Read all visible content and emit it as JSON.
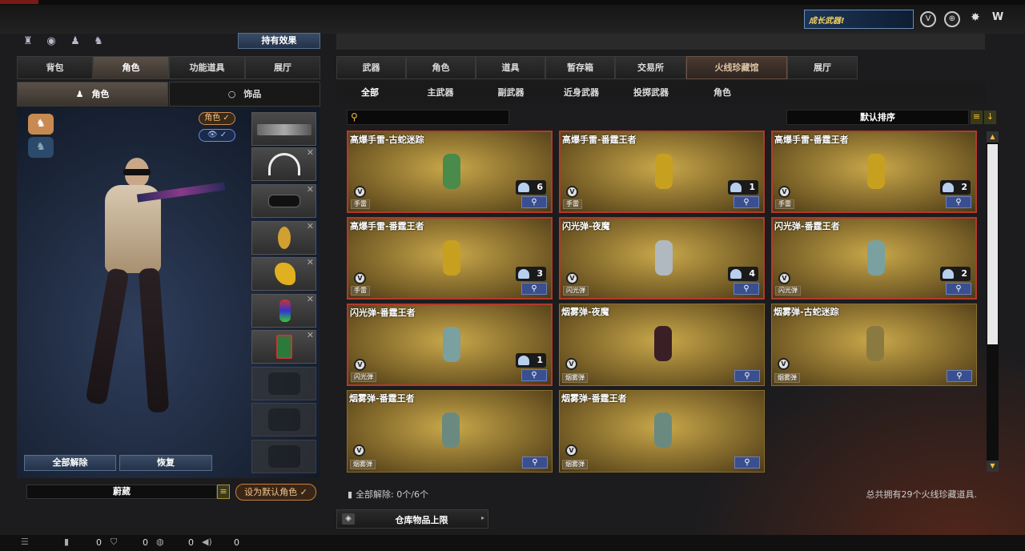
{
  "top": {
    "banner_text": "成长武器!",
    "icons": [
      "shield-v-icon",
      "crosshair-icon",
      "grenade-icon",
      "w-logo-icon"
    ]
  },
  "left": {
    "top_icons": [
      "stats-icon",
      "eye-icon",
      "person-icon",
      "bag-icon"
    ],
    "effect_button": "持有效果",
    "tabs": [
      "背包",
      "角色",
      "功能道具",
      "展厅"
    ],
    "active_tab": "角色",
    "subtabs": [
      "角色",
      "饰品"
    ],
    "active_subtab": "角色",
    "role_pill": "角色 ✓",
    "eye_pill": "👁 ✓",
    "unequip_all": "全部解除",
    "restore": "恢复",
    "char_name": "蔚葳",
    "set_default": "设为默认角色 ✓"
  },
  "right": {
    "tabs": [
      "武器",
      "角色",
      "道具",
      "暂存箱",
      "交易所",
      "火线珍藏馆",
      "展厅"
    ],
    "active_tab": "火线珍藏馆",
    "subtabs": [
      "全部",
      "主武器",
      "副武器",
      "近身武器",
      "投掷武器",
      "角色"
    ],
    "active_subtab": "全部",
    "search_placeholder": "",
    "sort_label": "默认排序",
    "items": [
      {
        "name": "高爆手雷-古蛇迷踪",
        "qty": "6",
        "type": "手雷",
        "color": "#4a8a4a",
        "red": true
      },
      {
        "name": "高爆手雷-番霆王者",
        "qty": "1",
        "type": "手雷",
        "color": "#c8a020",
        "red": true
      },
      {
        "name": "高爆手雷-番霆王者",
        "qty": "2",
        "type": "手雷",
        "color": "#c8a020",
        "red": true
      },
      {
        "name": "高爆手雷-番霆王者",
        "qty": "3",
        "type": "手雷",
        "color": "#c8a020",
        "red": true
      },
      {
        "name": "闪光弹-夜魔",
        "qty": "4",
        "type": "闪光弹",
        "color": "#b0b8c0",
        "red": true
      },
      {
        "name": "闪光弹-番霆王者",
        "qty": "2",
        "type": "闪光弹",
        "color": "#7aa0a0",
        "red": true
      },
      {
        "name": "闪光弹-番霆王者",
        "qty": "1",
        "type": "闪光弹",
        "color": "#7aa0a0",
        "red": true
      },
      {
        "name": "烟雾弹-夜魔",
        "qty": "",
        "type": "烟雾弹",
        "color": "#3a2024",
        "red": false
      },
      {
        "name": "烟雾弹-古蛇迷踪",
        "qty": "",
        "type": "烟雾弹",
        "color": "#8a7a40",
        "red": false
      },
      {
        "name": "烟雾弹-番霆王者",
        "qty": "",
        "type": "烟雾弹",
        "color": "#6a8a80",
        "red": false
      },
      {
        "name": "烟雾弹-番霆王者",
        "qty": "",
        "type": "烟雾弹",
        "color": "#6a8a80",
        "red": false
      }
    ],
    "unequip_status": "全部解除: 0个/6个",
    "total_text": "总共拥有29个火线珍藏道具.",
    "storage_button": "仓库物品上限"
  },
  "bottom": {
    "counts": [
      "0",
      "0",
      "0",
      "0"
    ]
  }
}
